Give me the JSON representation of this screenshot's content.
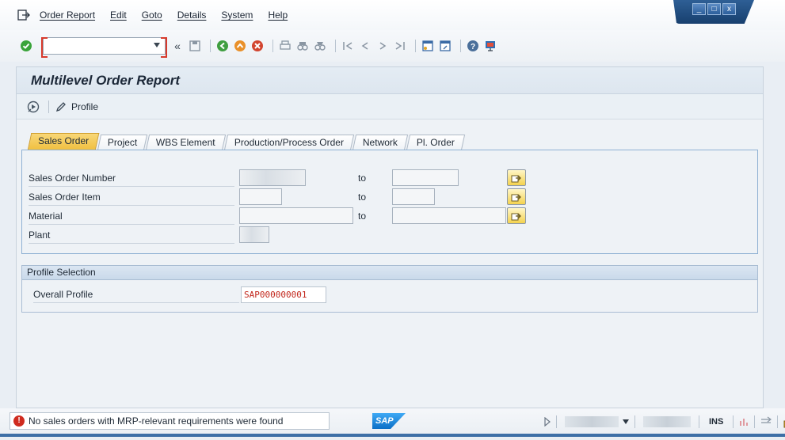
{
  "menu": {
    "items": [
      "Order Report",
      "Edit",
      "Goto",
      "Details",
      "System",
      "Help"
    ]
  },
  "window_controls": {
    "minimize": "_",
    "maximize": "□",
    "close": "x"
  },
  "toolbar": {
    "command_field_value": "",
    "back_symbol": "«"
  },
  "page": {
    "title": "Multilevel Order Report",
    "profile_button_label": "Profile"
  },
  "tabs": [
    "Sales Order",
    "Project",
    "WBS Element",
    "Production/Process Order",
    "Network",
    "Pl. Order"
  ],
  "active_tab": "Sales Order",
  "sales_order_form": {
    "rows": [
      {
        "label": "Sales Order Number",
        "to_label": "to"
      },
      {
        "label": "Sales Order Item",
        "to_label": "to"
      },
      {
        "label": "Material",
        "to_label": "to"
      },
      {
        "label": "Plant"
      }
    ]
  },
  "profile_selection": {
    "section_title": "Profile Selection",
    "overall_profile_label": "Overall Profile",
    "overall_profile_value": "SAP000000001"
  },
  "status": {
    "message": "No sales orders with MRP-relevant requirements were found",
    "message_type": "error",
    "error_symbol": "!",
    "logo_text": "SAP",
    "mode": "INS"
  },
  "colors": {
    "accent_tab": "#f0bf3e",
    "error_red": "#cf2b1f",
    "window_blue": "#173f6e"
  }
}
